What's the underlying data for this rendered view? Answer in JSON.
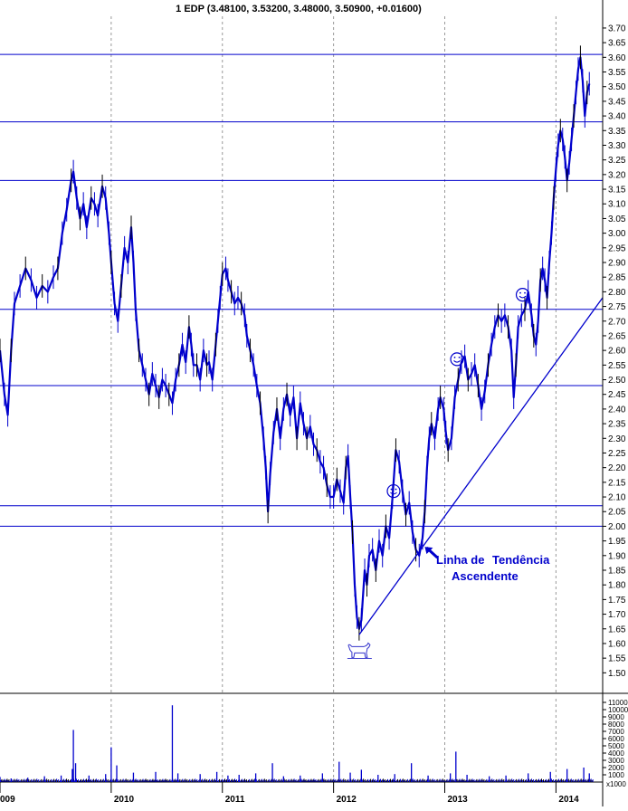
{
  "chart_data": {
    "type": "line",
    "title": "1 EDP (3.48100, 3.53200, 3.48000, 3.50900, +0.01600)",
    "xlabel": "",
    "ylabel": "",
    "ylim": [
      1.43,
      3.74
    ],
    "y_ticks": [
      "1.50",
      "1.55",
      "1.60",
      "1.65",
      "1.70",
      "1.75",
      "1.80",
      "1.85",
      "1.90",
      "1.95",
      "2.00",
      "2.05",
      "2.10",
      "2.15",
      "2.20",
      "2.25",
      "2.30",
      "2.35",
      "2.40",
      "2.45",
      "2.50",
      "2.55",
      "2.60",
      "2.65",
      "2.70",
      "2.75",
      "2.80",
      "2.85",
      "2.90",
      "2.95",
      "3.00",
      "3.05",
      "3.10",
      "3.15",
      "3.20",
      "3.25",
      "3.30",
      "3.35",
      "3.40",
      "3.45",
      "3.50",
      "3.55",
      "3.60",
      "3.65",
      "3.70"
    ],
    "x_ticks": [
      {
        "t": 0.0,
        "label": "009"
      },
      {
        "t": 1.0,
        "label": "2010"
      },
      {
        "t": 2.0,
        "label": "2011"
      },
      {
        "t": 3.0,
        "label": "2012"
      },
      {
        "t": 4.0,
        "label": "2013"
      },
      {
        "t": 5.0,
        "label": "2014"
      }
    ],
    "xlim": [
      0.0,
      5.42
    ],
    "series": [
      {
        "color": "#0000cc",
        "points": [
          [
            0.0,
            2.6
          ],
          [
            0.04,
            2.45
          ],
          [
            0.07,
            2.38
          ],
          [
            0.1,
            2.6
          ],
          [
            0.13,
            2.76
          ],
          [
            0.18,
            2.82
          ],
          [
            0.23,
            2.88
          ],
          [
            0.28,
            2.84
          ],
          [
            0.33,
            2.78
          ],
          [
            0.38,
            2.82
          ],
          [
            0.43,
            2.8
          ],
          [
            0.48,
            2.85
          ],
          [
            0.52,
            2.88
          ],
          [
            0.56,
            3.0
          ],
          [
            0.6,
            3.08
          ],
          [
            0.64,
            3.18
          ],
          [
            0.66,
            3.21
          ],
          [
            0.69,
            3.12
          ],
          [
            0.72,
            3.05
          ],
          [
            0.75,
            3.1
          ],
          [
            0.78,
            3.02
          ],
          [
            0.82,
            3.12
          ],
          [
            0.85,
            3.1
          ],
          [
            0.88,
            3.06
          ],
          [
            0.92,
            3.16
          ],
          [
            0.95,
            3.12
          ],
          [
            0.98,
            3.0
          ],
          [
            1.0,
            2.9
          ],
          [
            1.03,
            2.76
          ],
          [
            1.06,
            2.7
          ],
          [
            1.09,
            2.82
          ],
          [
            1.12,
            2.95
          ],
          [
            1.15,
            2.9
          ],
          [
            1.18,
            3.02
          ],
          [
            1.2,
            2.9
          ],
          [
            1.22,
            2.74
          ],
          [
            1.25,
            2.6
          ],
          [
            1.28,
            2.55
          ],
          [
            1.31,
            2.5
          ],
          [
            1.34,
            2.45
          ],
          [
            1.37,
            2.52
          ],
          [
            1.4,
            2.48
          ],
          [
            1.43,
            2.44
          ],
          [
            1.46,
            2.5
          ],
          [
            1.49,
            2.48
          ],
          [
            1.52,
            2.45
          ],
          [
            1.55,
            2.42
          ],
          [
            1.58,
            2.5
          ],
          [
            1.61,
            2.55
          ],
          [
            1.64,
            2.62
          ],
          [
            1.67,
            2.56
          ],
          [
            1.7,
            2.68
          ],
          [
            1.72,
            2.62
          ],
          [
            1.74,
            2.55
          ],
          [
            1.77,
            2.55
          ],
          [
            1.8,
            2.5
          ],
          [
            1.83,
            2.6
          ],
          [
            1.86,
            2.55
          ],
          [
            1.88,
            2.56
          ],
          [
            1.91,
            2.5
          ],
          [
            1.94,
            2.62
          ],
          [
            1.96,
            2.7
          ],
          [
            1.98,
            2.78
          ],
          [
            2.0,
            2.86
          ],
          [
            2.03,
            2.88
          ],
          [
            2.05,
            2.84
          ],
          [
            2.08,
            2.8
          ],
          [
            2.11,
            2.76
          ],
          [
            2.14,
            2.78
          ],
          [
            2.17,
            2.76
          ],
          [
            2.2,
            2.72
          ],
          [
            2.22,
            2.65
          ],
          [
            2.25,
            2.6
          ],
          [
            2.28,
            2.55
          ],
          [
            2.31,
            2.48
          ],
          [
            2.34,
            2.42
          ],
          [
            2.37,
            2.3
          ],
          [
            2.39,
            2.2
          ],
          [
            2.41,
            2.05
          ],
          [
            2.43,
            2.18
          ],
          [
            2.46,
            2.32
          ],
          [
            2.49,
            2.4
          ],
          [
            2.52,
            2.3
          ],
          [
            2.55,
            2.4
          ],
          [
            2.58,
            2.45
          ],
          [
            2.61,
            2.38
          ],
          [
            2.64,
            2.44
          ],
          [
            2.67,
            2.3
          ],
          [
            2.7,
            2.42
          ],
          [
            2.73,
            2.35
          ],
          [
            2.76,
            2.3
          ],
          [
            2.79,
            2.34
          ],
          [
            2.82,
            2.28
          ],
          [
            2.85,
            2.26
          ],
          [
            2.88,
            2.22
          ],
          [
            2.91,
            2.2
          ],
          [
            2.94,
            2.14
          ],
          [
            2.97,
            2.1
          ],
          [
            3.0,
            2.1
          ],
          [
            3.03,
            2.16
          ],
          [
            3.06,
            2.12
          ],
          [
            3.09,
            2.08
          ],
          [
            3.11,
            2.2
          ],
          [
            3.13,
            2.24
          ],
          [
            3.15,
            2.1
          ],
          [
            3.17,
            1.98
          ],
          [
            3.19,
            1.8
          ],
          [
            3.21,
            1.69
          ],
          [
            3.23,
            1.65
          ],
          [
            3.25,
            1.68
          ],
          [
            3.28,
            1.85
          ],
          [
            3.3,
            1.8
          ],
          [
            3.32,
            1.9
          ],
          [
            3.35,
            1.92
          ],
          [
            3.38,
            1.85
          ],
          [
            3.41,
            1.95
          ],
          [
            3.44,
            1.9
          ],
          [
            3.47,
            2.0
          ],
          [
            3.5,
            1.96
          ],
          [
            3.53,
            2.1
          ],
          [
            3.56,
            2.26
          ],
          [
            3.59,
            2.22
          ],
          [
            3.62,
            2.12
          ],
          [
            3.65,
            2.04
          ],
          [
            3.68,
            2.08
          ],
          [
            3.71,
            1.98
          ],
          [
            3.74,
            1.92
          ],
          [
            3.77,
            1.9
          ],
          [
            3.8,
            1.96
          ],
          [
            3.82,
            2.05
          ],
          [
            3.84,
            2.2
          ],
          [
            3.86,
            2.3
          ],
          [
            3.88,
            2.35
          ],
          [
            3.91,
            2.3
          ],
          [
            3.94,
            2.4
          ],
          [
            3.96,
            2.44
          ],
          [
            3.99,
            2.4
          ],
          [
            4.01,
            2.32
          ],
          [
            4.03,
            2.26
          ],
          [
            4.06,
            2.3
          ],
          [
            4.09,
            2.44
          ],
          [
            4.12,
            2.5
          ],
          [
            4.15,
            2.56
          ],
          [
            4.18,
            2.58
          ],
          [
            4.21,
            2.5
          ],
          [
            4.24,
            2.52
          ],
          [
            4.27,
            2.55
          ],
          [
            4.3,
            2.48
          ],
          [
            4.33,
            2.4
          ],
          [
            4.36,
            2.46
          ],
          [
            4.39,
            2.55
          ],
          [
            4.42,
            2.62
          ],
          [
            4.45,
            2.68
          ],
          [
            4.48,
            2.72
          ],
          [
            4.51,
            2.7
          ],
          [
            4.54,
            2.72
          ],
          [
            4.57,
            2.68
          ],
          [
            4.6,
            2.6
          ],
          [
            4.62,
            2.44
          ],
          [
            4.64,
            2.55
          ],
          [
            4.66,
            2.68
          ],
          [
            4.69,
            2.72
          ],
          [
            4.72,
            2.74
          ],
          [
            4.75,
            2.8
          ],
          [
            4.78,
            2.72
          ],
          [
            4.8,
            2.65
          ],
          [
            4.82,
            2.62
          ],
          [
            4.84,
            2.7
          ],
          [
            4.86,
            2.84
          ],
          [
            4.88,
            2.88
          ],
          [
            4.9,
            2.84
          ],
          [
            4.92,
            2.78
          ],
          [
            4.94,
            2.9
          ],
          [
            4.96,
            3.0
          ],
          [
            4.98,
            3.12
          ],
          [
            5.0,
            3.22
          ],
          [
            5.02,
            3.3
          ],
          [
            5.04,
            3.35
          ],
          [
            5.06,
            3.32
          ],
          [
            5.08,
            3.26
          ],
          [
            5.1,
            3.18
          ],
          [
            5.12,
            3.24
          ],
          [
            5.14,
            3.32
          ],
          [
            5.16,
            3.4
          ],
          [
            5.18,
            3.48
          ],
          [
            5.2,
            3.56
          ],
          [
            5.22,
            3.6
          ],
          [
            5.24,
            3.52
          ],
          [
            5.26,
            3.4
          ],
          [
            5.28,
            3.48
          ],
          [
            5.3,
            3.51
          ]
        ]
      }
    ],
    "volume": {
      "ylim": [
        0,
        11500
      ],
      "y_ticks": [
        "1000",
        "2000",
        "3000",
        "4000",
        "5000",
        "6000",
        "7000",
        "8000",
        "9000",
        "10000",
        "11000"
      ],
      "scale_label": "x1000",
      "baseline": 300,
      "spikes": [
        [
          0.0,
          700
        ],
        [
          0.1,
          500
        ],
        [
          0.25,
          600
        ],
        [
          0.4,
          800
        ],
        [
          0.55,
          900
        ],
        [
          0.65,
          1800
        ],
        [
          0.66,
          7200
        ],
        [
          0.68,
          2600
        ],
        [
          0.8,
          900
        ],
        [
          0.95,
          1100
        ],
        [
          1.0,
          4800
        ],
        [
          1.05,
          2300
        ],
        [
          1.2,
          1300
        ],
        [
          1.4,
          1400
        ],
        [
          1.55,
          10600
        ],
        [
          1.6,
          1200
        ],
        [
          1.8,
          1100
        ],
        [
          1.95,
          1400
        ],
        [
          2.05,
          900
        ],
        [
          2.15,
          1000
        ],
        [
          2.3,
          1200
        ],
        [
          2.45,
          2600
        ],
        [
          2.55,
          800
        ],
        [
          2.7,
          900
        ],
        [
          2.9,
          1200
        ],
        [
          3.05,
          2800
        ],
        [
          3.15,
          1300
        ],
        [
          3.25,
          1700
        ],
        [
          3.4,
          1000
        ],
        [
          3.55,
          1100
        ],
        [
          3.7,
          2600
        ],
        [
          3.85,
          900
        ],
        [
          4.05,
          1200
        ],
        [
          4.1,
          4200
        ],
        [
          4.2,
          1000
        ],
        [
          4.4,
          800
        ],
        [
          4.55,
          900
        ],
        [
          4.75,
          1200
        ],
        [
          4.95,
          1400
        ],
        [
          5.1,
          1800
        ],
        [
          5.25,
          2000
        ],
        [
          5.3,
          1200
        ]
      ]
    },
    "horizontal_lines": [
      3.61,
      3.38,
      3.18,
      2.74,
      2.48,
      2.07,
      2.0
    ],
    "trendline": {
      "label": "Linha de Tendência Ascendente",
      "from": [
        3.23,
        1.63
      ],
      "to": [
        5.42,
        2.78
      ]
    },
    "annotations": {
      "trend_label_line1": "Linha de",
      "trend_label_line1b": "Tendência",
      "trend_label_line2": "Ascendente",
      "smileys": [
        [
          3.54,
          2.12
        ],
        [
          4.11,
          2.57
        ],
        [
          4.7,
          2.79
        ]
      ],
      "bull_at": [
        3.23,
        1.58
      ],
      "arrow_at": [
        3.82,
        1.93
      ]
    }
  }
}
